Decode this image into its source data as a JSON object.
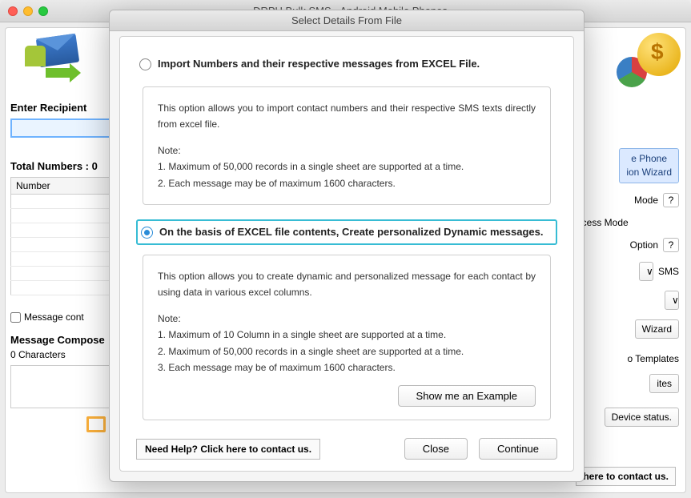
{
  "parent": {
    "title": "DRPU Bulk SMS - Android Mobile Phones",
    "left": {
      "recipient_label": "Enter Recipient",
      "total_numbers_label": "Total Numbers : 0",
      "number_col": "Number",
      "msg_contains_chk": "Message cont",
      "composer_label": "Message Compose",
      "chars": "0 Characters"
    },
    "right": {
      "phone_btn_line1": "e Phone",
      "phone_btn_line2": "ion  Wizard",
      "mode_label": "Mode",
      "process_label": "Process Mode",
      "option_label": "Option",
      "sms_label": "SMS",
      "wizard_btn": "Wizard",
      "templates_label": "o Templates",
      "rtes_btn": "ites",
      "device_status": "Device status.",
      "help": "here to contact us."
    }
  },
  "modal": {
    "title": "Select Details From File",
    "opt1": {
      "label": "Import Numbers and their respective messages from EXCEL File.",
      "desc": "This option allows you to import contact numbers and their respective SMS texts directly from excel file.",
      "note_h": "Note:",
      "n1": "1. Maximum of 50,000 records in a single sheet are supported at a time.",
      "n2": "2. Each message may be of maximum 1600 characters."
    },
    "opt2": {
      "label": "On the basis of EXCEL file contents, Create personalized Dynamic messages.",
      "desc": "This option allows you to create dynamic and personalized message for each contact by using data in various excel columns.",
      "note_h": "Note:",
      "n1": "1. Maximum of 10 Column in a single sheet are supported at a time.",
      "n2": "2. Maximum of 50,000 records in a single sheet are supported at a time.",
      "n3": "3. Each message may be of maximum 1600 characters.",
      "example_btn": "Show me an Example"
    },
    "footer": {
      "help": "Need Help? Click here to contact us.",
      "close": "Close",
      "continue": "Continue"
    }
  },
  "icons": {
    "q": "?"
  }
}
